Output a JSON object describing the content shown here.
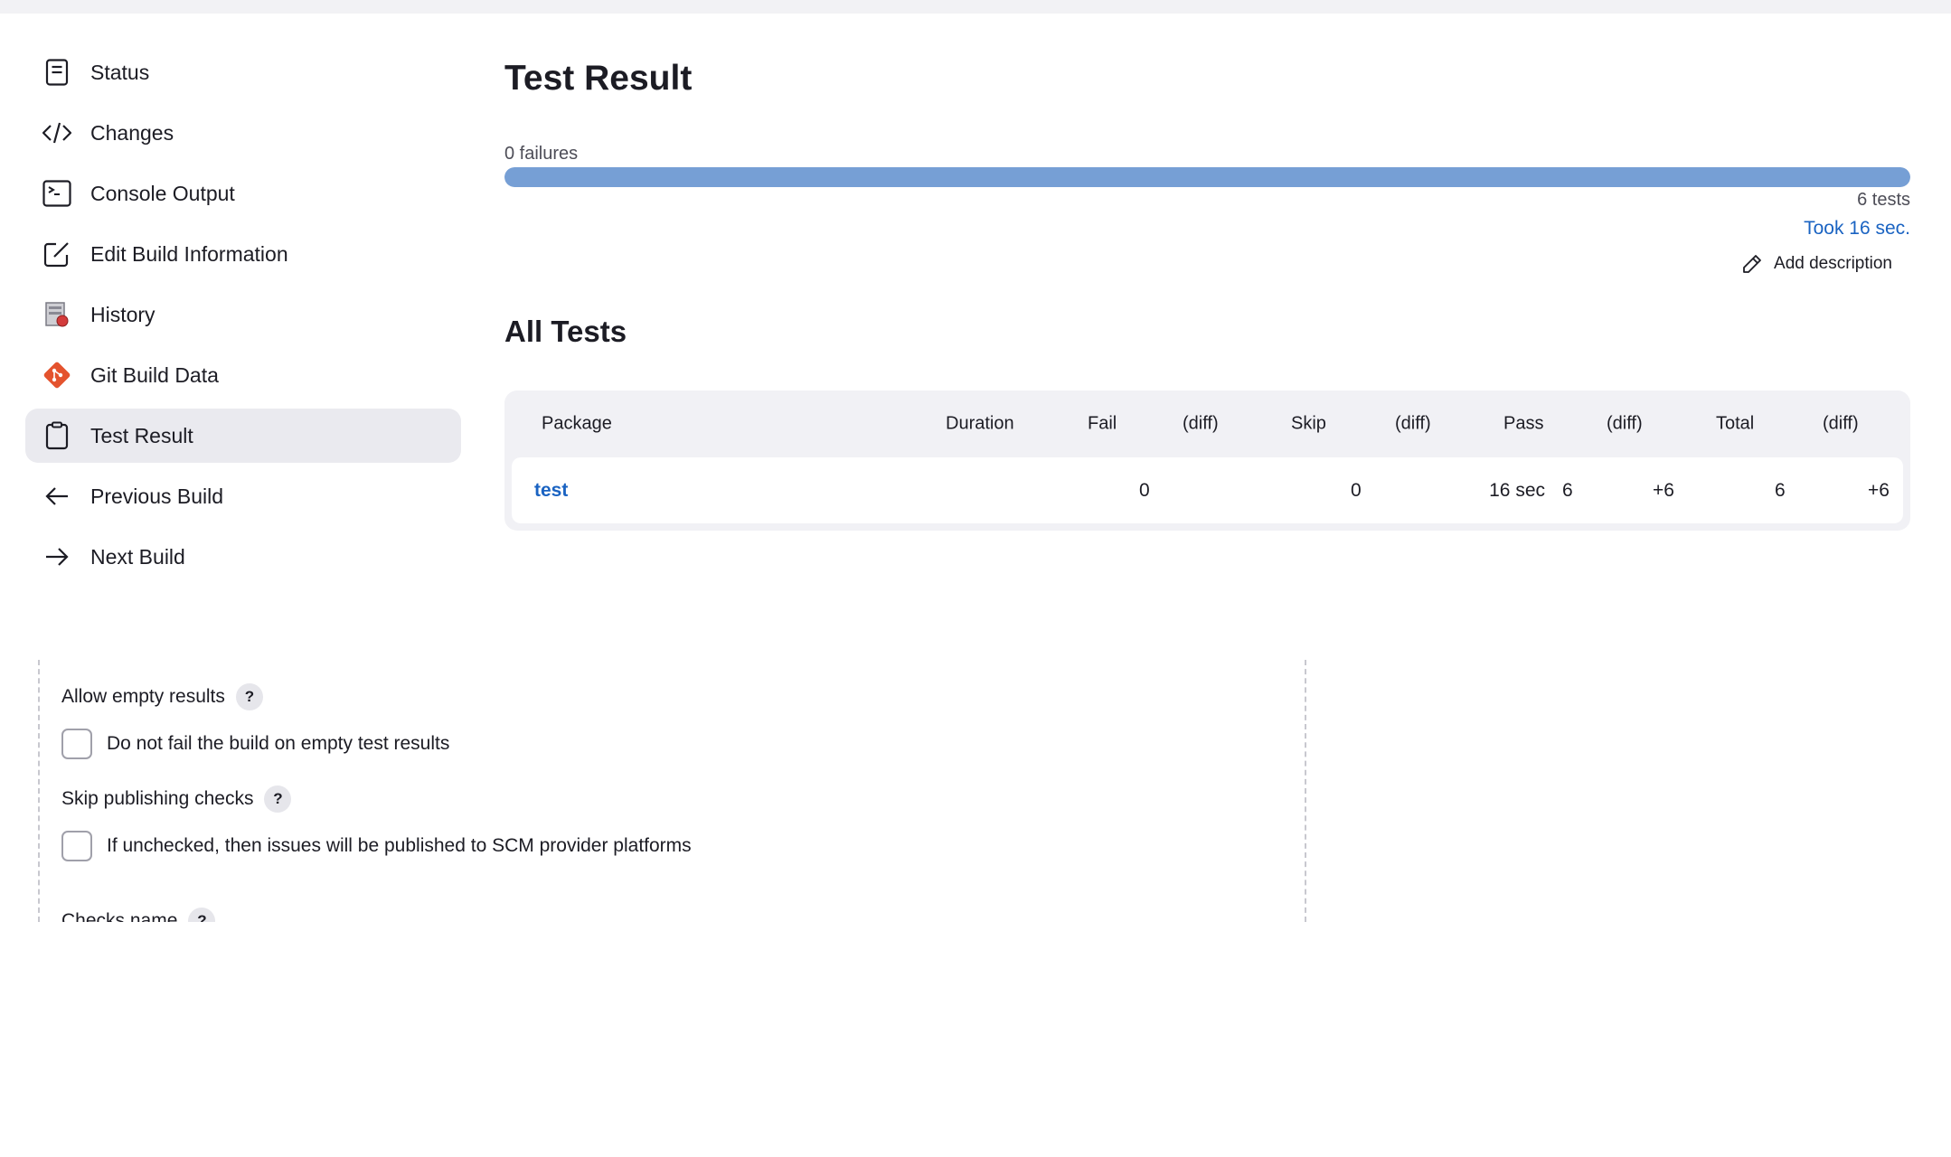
{
  "sidebar": {
    "items": [
      {
        "label": "Status",
        "icon": "document-icon"
      },
      {
        "label": "Changes",
        "icon": "code-icon"
      },
      {
        "label": "Console Output",
        "icon": "terminal-icon"
      },
      {
        "label": "Edit Build Information",
        "icon": "edit-icon"
      },
      {
        "label": "History",
        "icon": "history-icon"
      },
      {
        "label": "Git Build Data",
        "icon": "git-icon"
      },
      {
        "label": "Test Result",
        "icon": "clipboard-icon",
        "active": true
      },
      {
        "label": "Previous Build",
        "icon": "arrow-left-icon"
      },
      {
        "label": "Next Build",
        "icon": "arrow-right-icon"
      }
    ]
  },
  "main": {
    "title": "Test Result",
    "failures_text": "0 failures",
    "progress_pass_fraction": 1.0,
    "tests_text": "6 tests",
    "took_text": "Took 16 sec.",
    "add_description": "Add description",
    "all_tests_title": "All Tests"
  },
  "table": {
    "headers": [
      "Package",
      "Duration",
      "Fail",
      "(diff)",
      "Skip",
      "(diff)",
      "Pass",
      "(diff)",
      "Total",
      "(diff)"
    ],
    "rows": [
      {
        "package": "test",
        "duration": "16 sec",
        "fail": "0",
        "fail_diff": "",
        "skip": "0",
        "skip_diff": "",
        "pass": "6",
        "pass_diff": "+6",
        "total": "6",
        "total_diff": "+6"
      }
    ]
  },
  "config": {
    "allow_empty_label": "Allow empty results",
    "allow_empty_checkbox": "Do not fail the build on empty test results",
    "skip_checks_label": "Skip publishing checks",
    "skip_checks_checkbox": "If unchecked, then issues will be published to SCM provider platforms",
    "checks_name_label": "Checks name",
    "help": "?"
  },
  "colors": {
    "accent": "#1a63c2",
    "progress": "#769fd5",
    "git": "#e4532e"
  }
}
